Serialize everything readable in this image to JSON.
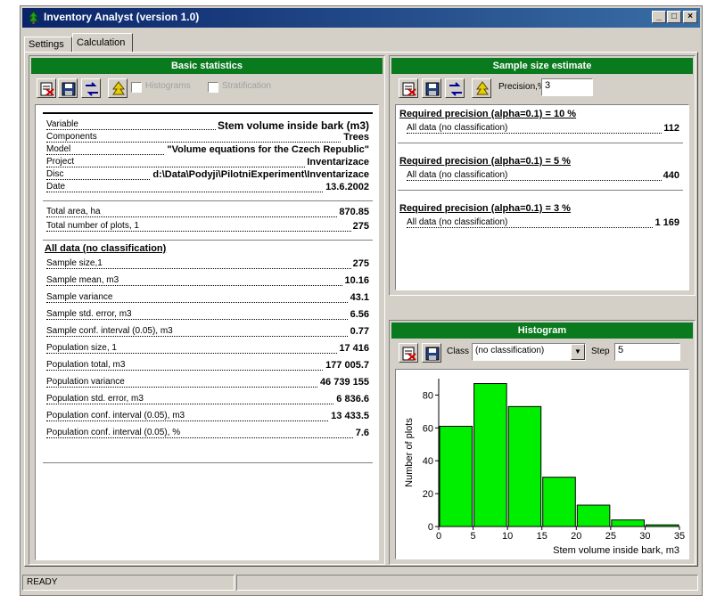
{
  "window": {
    "title": "Inventory Analyst (version 1.0)",
    "minimize": "_",
    "maximize": "□",
    "close": "×"
  },
  "tabs": [
    {
      "label": "Settings"
    },
    {
      "label": "Calculation"
    }
  ],
  "basic": {
    "header": "Basic statistics",
    "checkbox1": "Histograms",
    "checkbox2": "Stratification",
    "info": [
      {
        "label": "Variable",
        "value": "Stem volume inside bark (m3)"
      },
      {
        "label": "Components",
        "value": "Trees"
      },
      {
        "label": "Model",
        "value": "\"Volume equations for the Czech Republic\""
      },
      {
        "label": "Project",
        "value": "Inventarizace"
      },
      {
        "label": "Disc",
        "value": "d:\\Data\\Podyji\\PilotniExperiment\\Inventarizace"
      },
      {
        "label": "Date",
        "value": "13.6.2002"
      }
    ],
    "totals": [
      {
        "label": "Total area, ha",
        "value": "870.85"
      },
      {
        "label": "Total number of plots, 1",
        "value": "275"
      }
    ],
    "section_title": "All data (no classification)",
    "stats": [
      {
        "label": "Sample size,1",
        "value": "275"
      },
      {
        "label": "Sample mean, m3",
        "value": "10.16"
      },
      {
        "label": "Sample variance",
        "value": "43.1"
      },
      {
        "label": "Sample std. error, m3",
        "value": "6.56"
      },
      {
        "label": "Sample conf. interval (0.05), m3",
        "value": "0.77"
      },
      {
        "label": "Population size, 1",
        "value": "17 416"
      },
      {
        "label": "Population total, m3",
        "value": "177 005.7"
      },
      {
        "label": "Population variance",
        "value": "46 739 155"
      },
      {
        "label": "Population std. error, m3",
        "value": "6 836.6"
      },
      {
        "label": "Population conf. interval (0.05), m3",
        "value": "13 433.5"
      },
      {
        "label": "Population conf. interval (0.05), %",
        "value": "7.6"
      }
    ]
  },
  "sample": {
    "header": "Sample size estimate",
    "precision_label": "Precision,%",
    "precision_value": "3",
    "groups": [
      {
        "title": "Required precision (alpha=0.1) = 10 %",
        "label": "All data (no classification)",
        "value": "112"
      },
      {
        "title": "Required precision (alpha=0.1) = 5 %",
        "label": "All data (no classification)",
        "value": "440"
      },
      {
        "title": "Required precision (alpha=0.1) = 3 %",
        "label": "All data (no classification)",
        "value": "1 169"
      }
    ]
  },
  "histogram": {
    "header": "Histogram",
    "class_label": "Class",
    "class_value": "(no classification)",
    "step_label": "Step",
    "step_value": "5"
  },
  "chart_data": {
    "type": "bar",
    "categories": [
      "0-5",
      "5-10",
      "10-15",
      "15-20",
      "20-25",
      "25-30",
      "30-35"
    ],
    "values": [
      61,
      87,
      73,
      30,
      13,
      4,
      1
    ],
    "bin_edges": [
      0,
      5,
      10,
      15,
      20,
      25,
      30,
      35
    ],
    "xlabel": "Stem volume inside bark, m3",
    "ylabel": "Number of plots",
    "xticks": [
      "0",
      "5",
      "10",
      "15",
      "20",
      "25",
      "30",
      "35"
    ],
    "yticks": [
      "0",
      "20",
      "40",
      "60",
      "80"
    ],
    "ylim": [
      0,
      90
    ],
    "xlim": [
      0,
      35
    ],
    "bar_color": "#00ee00",
    "grid": false,
    "legend": "none"
  },
  "status": {
    "text": "READY"
  },
  "colors": {
    "panel_header": "#0a7a1e",
    "titlebar": "#0a246a",
    "bar": "#00ee00"
  }
}
